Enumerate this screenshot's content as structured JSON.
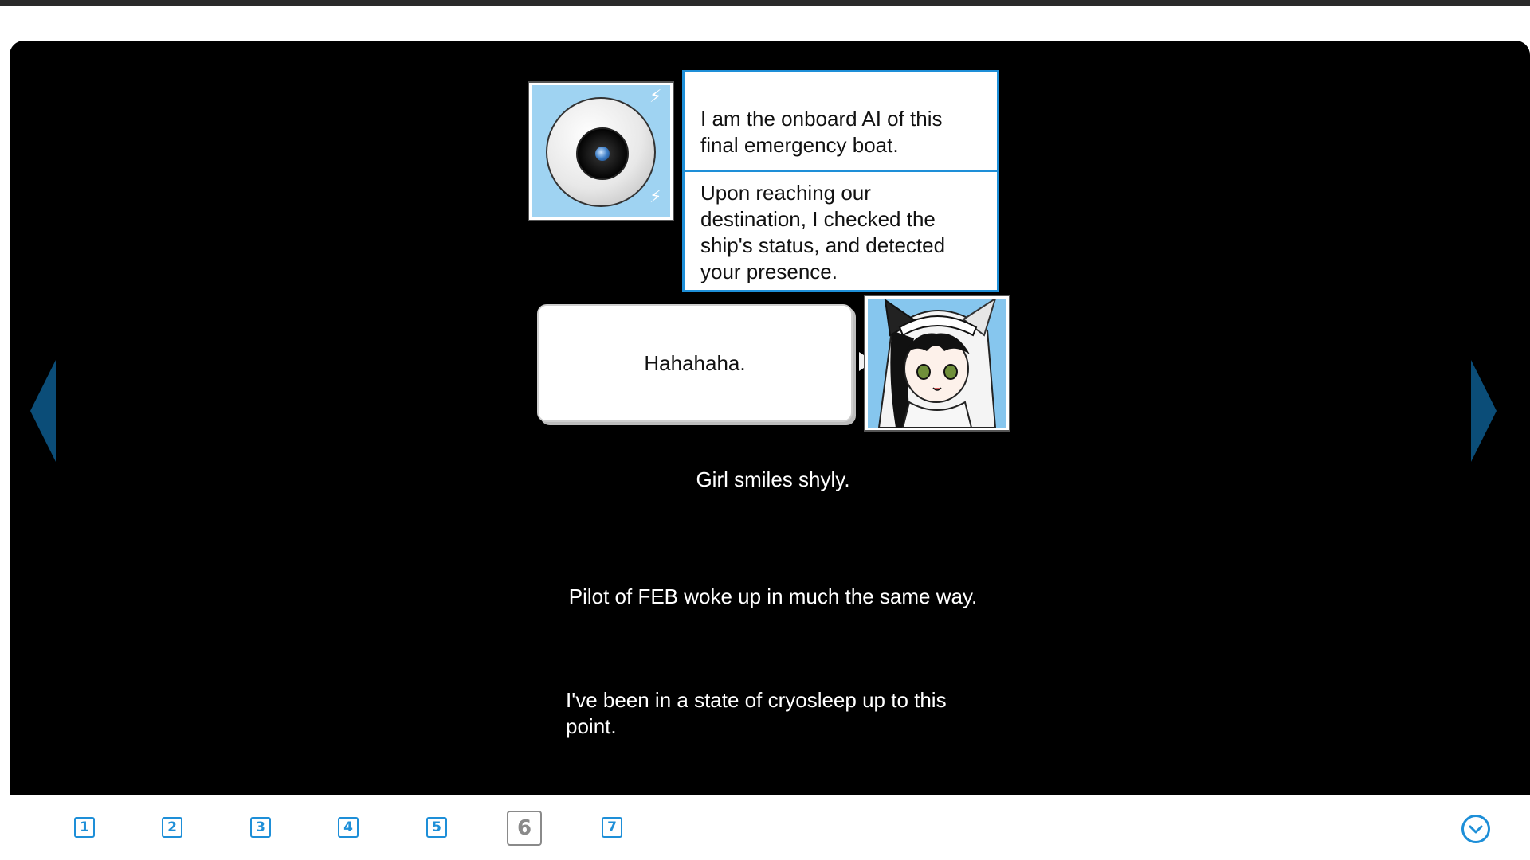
{
  "dialogue": {
    "ai_lines": [
      "I am the onboard AI of this final emergency boat.",
      "Upon reaching our destination, I checked the ship's status, and detected your presence."
    ],
    "girl_line": "Hahahaha."
  },
  "narration": [
    "Girl smiles shyly.",
    "Pilot of FEB woke up in much the same way.",
    "I've been in a state of cryosleep up to this point."
  ],
  "pages": {
    "items": [
      "1",
      "2",
      "3",
      "4",
      "5",
      "6",
      "7"
    ],
    "current": "6"
  },
  "colors": {
    "accent": "#1e8fd8",
    "nav_arrow": "#0b4d78",
    "stage_bg": "#000000"
  },
  "icons": {
    "prev": "triangle-left-icon",
    "next": "triangle-right-icon",
    "menu": "chevron-down-circle-icon"
  }
}
